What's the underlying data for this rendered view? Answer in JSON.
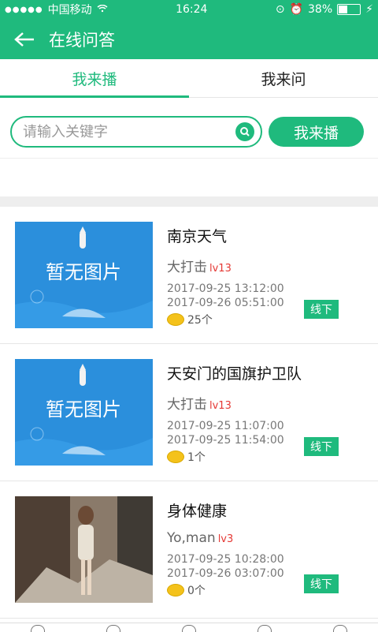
{
  "status": {
    "carrier": "中国移动",
    "time": "16:24",
    "battery": "38%",
    "battery_level": 0.38
  },
  "header": {
    "title": "在线问答"
  },
  "tabs": [
    {
      "label": "我来播"
    },
    {
      "label": "我来问"
    }
  ],
  "search": {
    "placeholder": "请输入关键字",
    "button": "我来播"
  },
  "items": [
    {
      "question": "南京天气",
      "author": "大打击",
      "level": "lv13",
      "time1": "2017-09-25 13:12:00",
      "time2": "2017-09-26 05:51:00",
      "coins": "25个",
      "tag": "线下",
      "image_text": "暂无图片"
    },
    {
      "question": "天安门的国旗护卫队",
      "author": "大打击",
      "level": "lv13",
      "time1": "2017-09-25 11:07:00",
      "time2": "2017-09-25 11:54:00",
      "coins": "1个",
      "tag": "线下",
      "image_text": "暂无图片"
    },
    {
      "question": "身体健康",
      "author": "Yo,man",
      "level": "lv3",
      "time1": "2017-09-25 10:28:00",
      "time2": "2017-09-26 03:07:00",
      "coins": "0个",
      "tag": "线下"
    }
  ],
  "colors": {
    "accent": "#1fba7d",
    "level": "#e53935",
    "coin": "#f4c21b"
  }
}
